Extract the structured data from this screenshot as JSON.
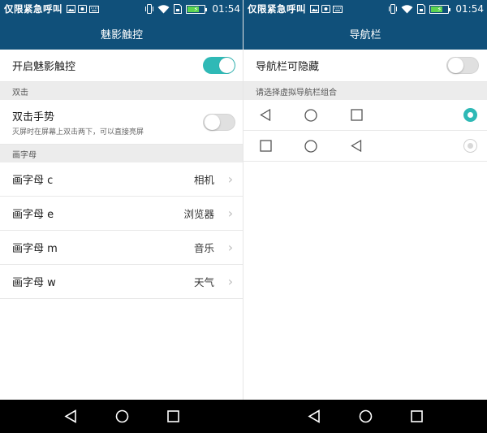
{
  "status": {
    "carrier": "仅限紧急呼叫",
    "time": "01:54"
  },
  "left": {
    "title": "魅影触控",
    "enable_label": "开启魅影触控",
    "enable_on": true,
    "section_double": "双击",
    "double_tap_title": "双击手势",
    "double_tap_sub": "灭屏时在屏幕上双击两下，可以直接亮屏",
    "double_tap_on": false,
    "section_letters": "画字母",
    "letters": [
      {
        "label": "画字母 c",
        "value": "相机"
      },
      {
        "label": "画字母 e",
        "value": "浏览器"
      },
      {
        "label": "画字母 m",
        "value": "音乐"
      },
      {
        "label": "画字母 w",
        "value": "天气"
      }
    ]
  },
  "right": {
    "title": "导航栏",
    "hide_label": "导航栏可隐藏",
    "hide_on": false,
    "section_combo": "请选择虚拟导航栏组合",
    "combos": [
      {
        "keys": [
          "back-icon",
          "home-icon",
          "recent-icon"
        ],
        "selected": true
      },
      {
        "keys": [
          "recent-icon",
          "home-icon",
          "back-icon"
        ],
        "selected": false
      }
    ]
  },
  "colors": {
    "header": "#10507a",
    "accent": "#2fb9b6",
    "section_bg": "#ececec"
  }
}
